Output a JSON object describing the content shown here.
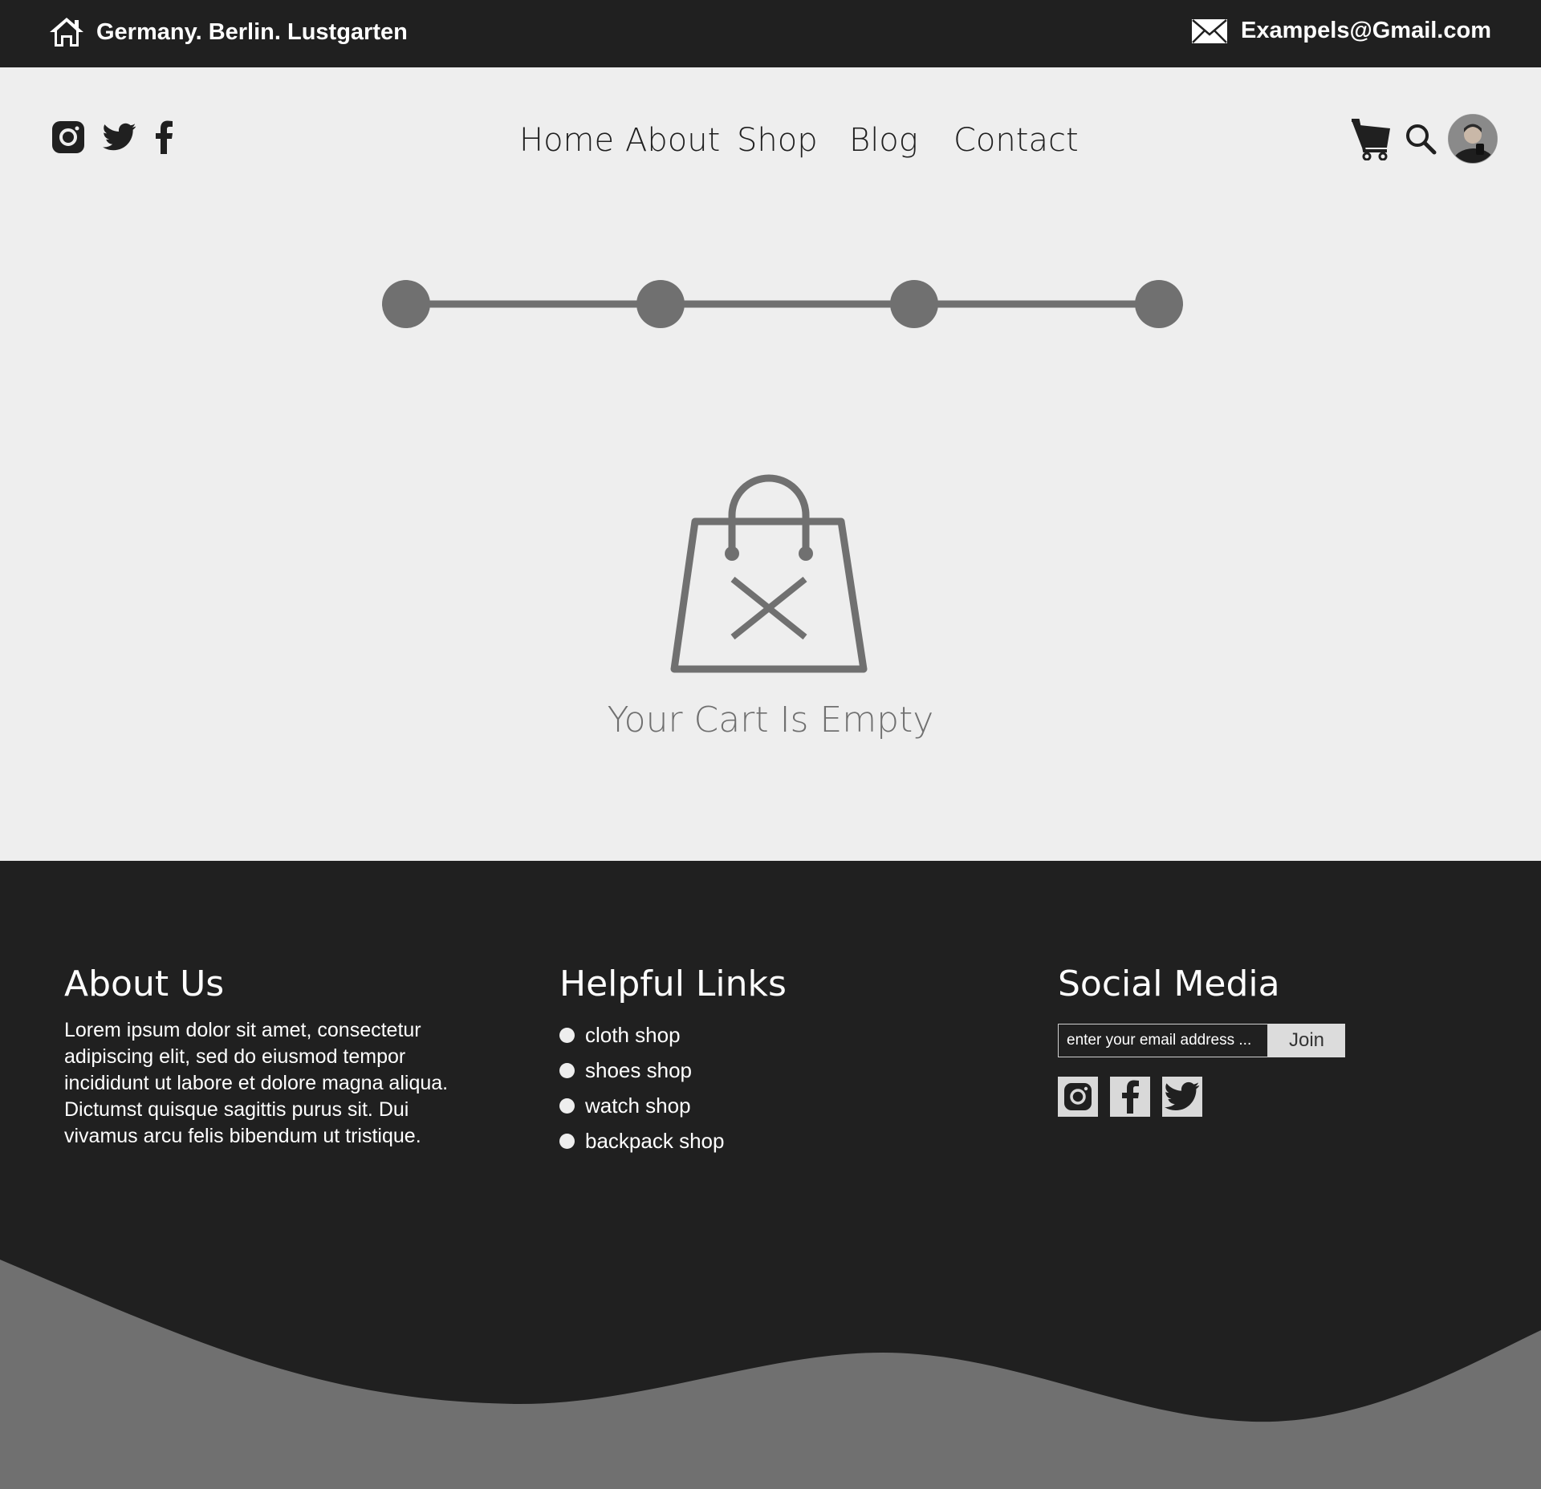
{
  "topbar": {
    "location": "Germany. Berlin. Lustgarten",
    "email": "Exampels@Gmail.com",
    "home_icon": "home-icon",
    "mail_icon": "envelope-icon"
  },
  "header": {
    "social_icons": [
      "instagram-icon",
      "twitter-icon",
      "facebook-icon"
    ],
    "nav": {
      "home": "Home",
      "about": "About",
      "shop": "Shop",
      "blog": "Blog",
      "contact": "Contact"
    },
    "tools": [
      "cart-icon",
      "search-icon",
      "avatar"
    ]
  },
  "stepper": {
    "steps": 4
  },
  "cart": {
    "icon": "empty-bag-icon",
    "message": "Your Cart Is Empty"
  },
  "footer": {
    "about": {
      "title": "About Us",
      "text": "Lorem ipsum dolor sit amet, consectetur adipiscing elit, sed do eiusmod tempor incididunt ut labore et dolore magna aliqua. Dictumst quisque sagittis purus sit. Dui vivamus arcu felis bibendum ut tristique."
    },
    "links": {
      "title": "Helpful Links",
      "items": [
        "cloth shop",
        "shoes shop",
        "watch shop",
        "backpack shop"
      ]
    },
    "social": {
      "title": "Social Media",
      "email_placeholder": "enter your email address ...",
      "join_label": "Join",
      "icons": [
        "instagram-icon",
        "facebook-icon",
        "twitter-icon"
      ]
    }
  },
  "colors": {
    "dark": "#202020",
    "light": "#eeeeee",
    "accent_gray": "#707070"
  }
}
